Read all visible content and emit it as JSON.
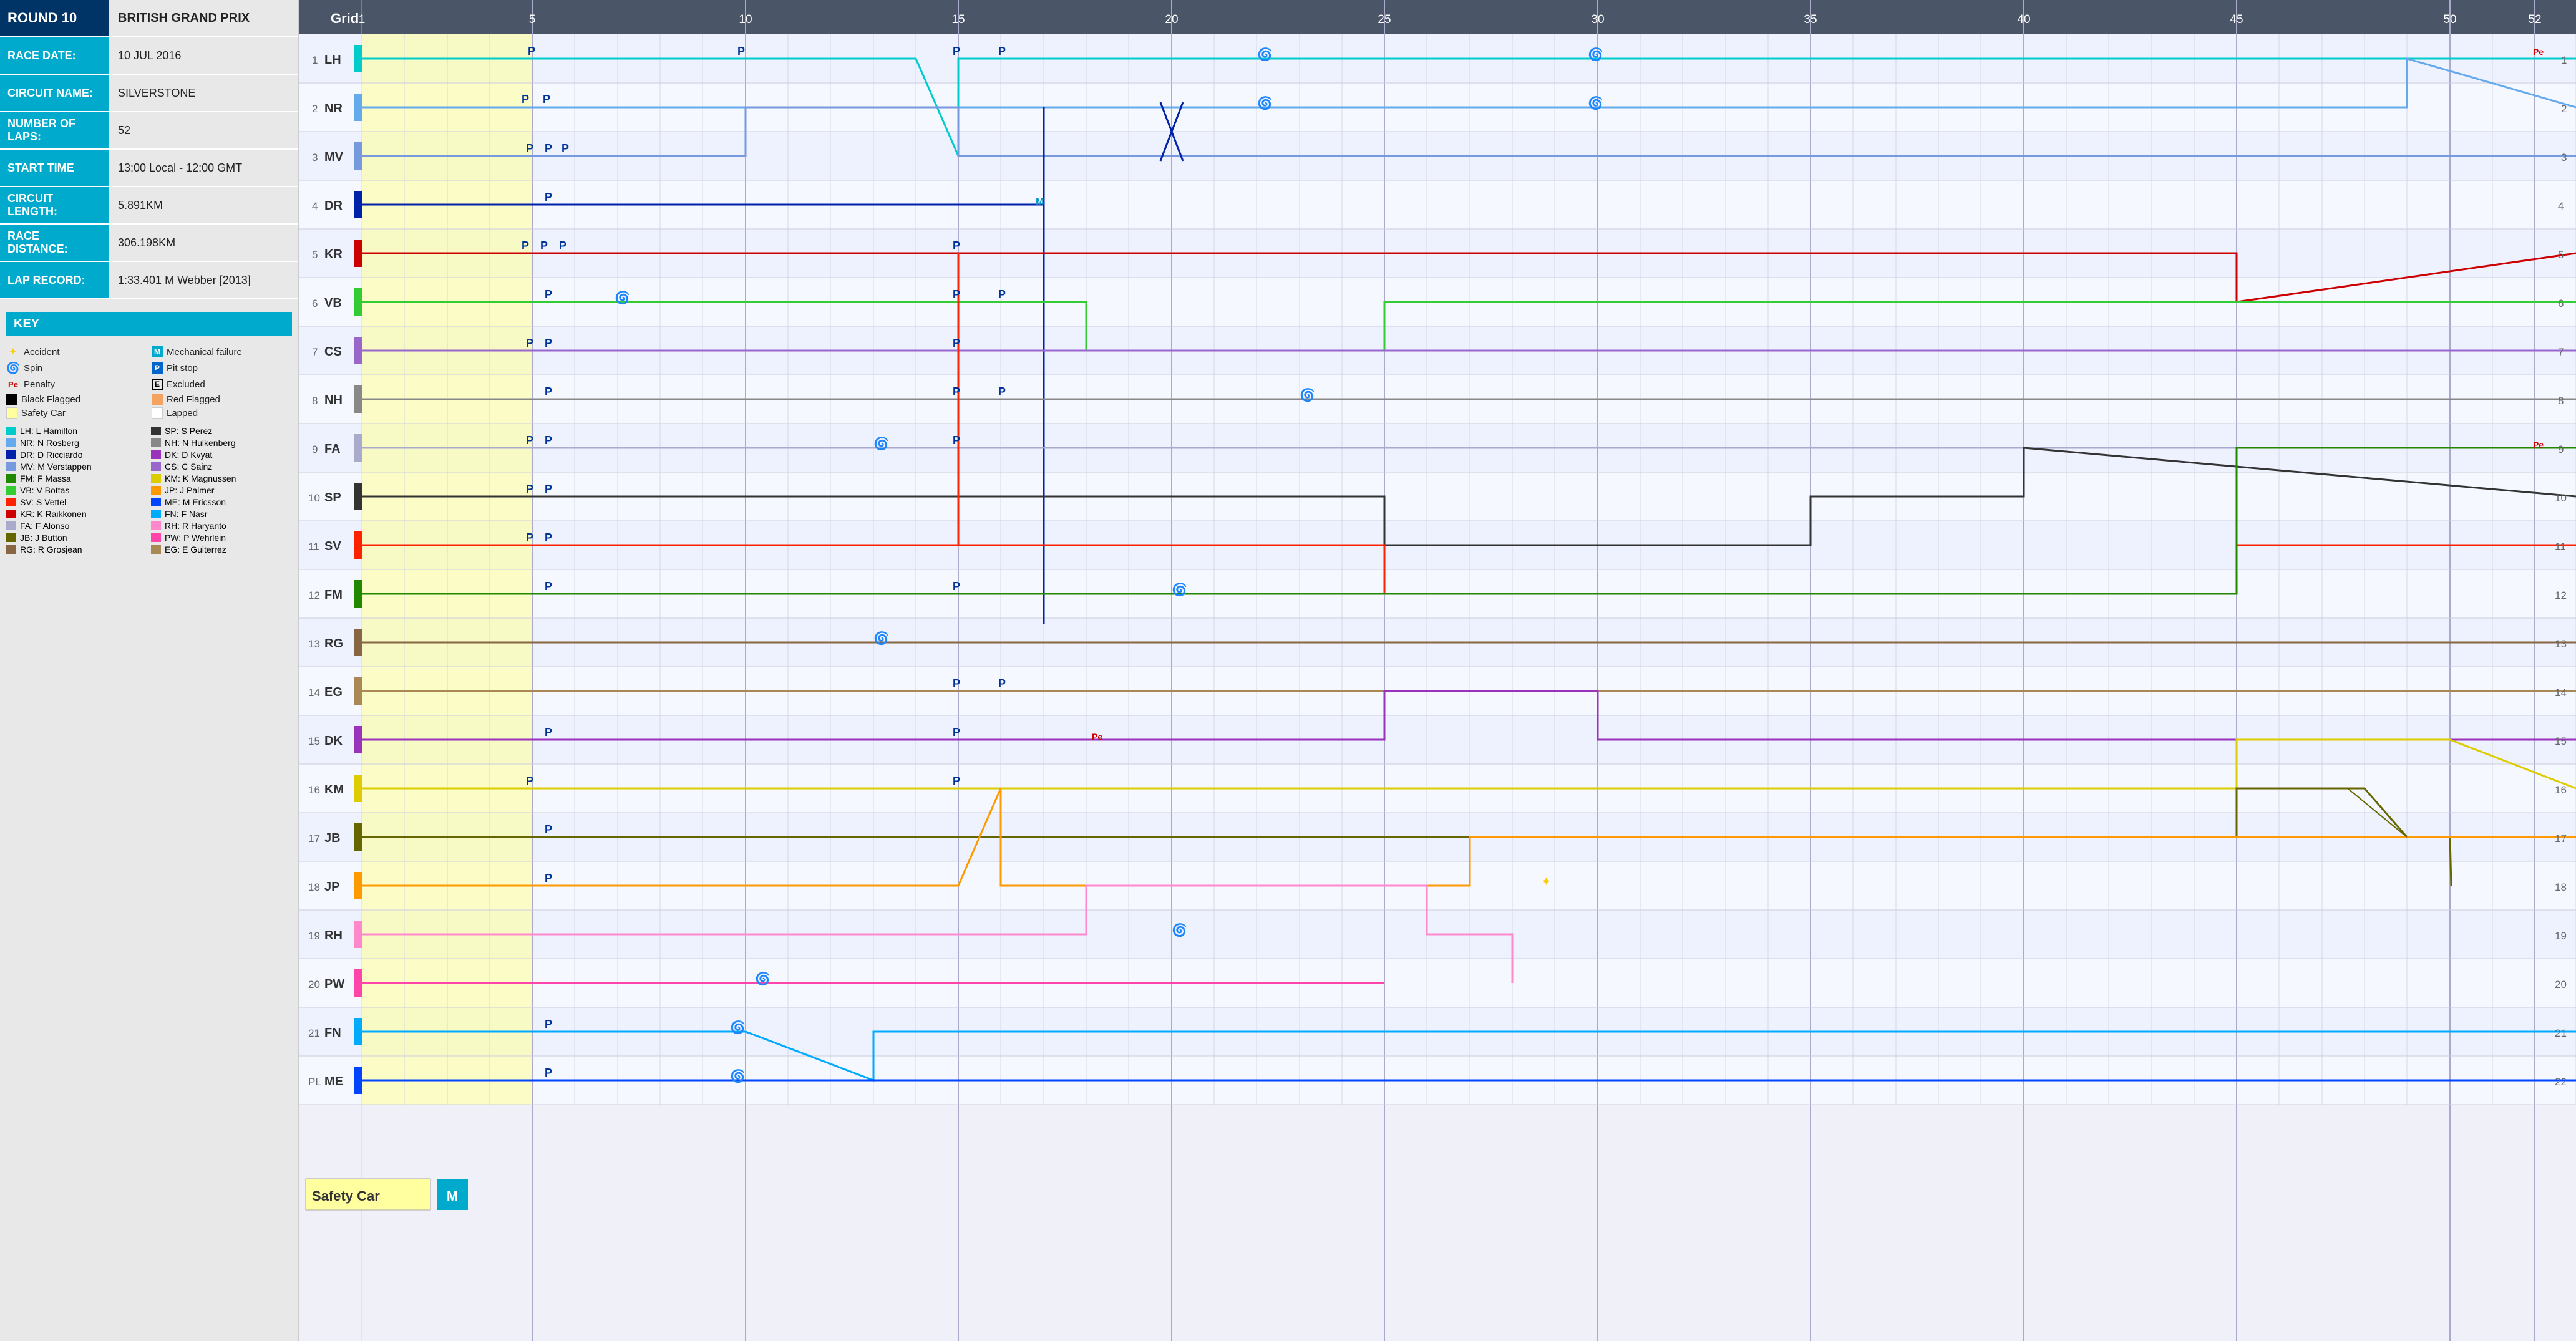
{
  "left_panel": {
    "round": "ROUND 10",
    "race_name": "BRITISH GRAND PRIX",
    "fields": [
      {
        "label": "RACE DATE:",
        "value": "10 JUL 2016"
      },
      {
        "label": "CIRCUIT NAME:",
        "value": "SILVERSTONE"
      },
      {
        "label": "NUMBER OF LAPS:",
        "value": "52"
      },
      {
        "label": "START TIME",
        "value": "13:00 Local - 12:00 GMT"
      },
      {
        "label": "CIRCUIT LENGTH:",
        "value": "5.891KM"
      },
      {
        "label": "RACE DISTANCE:",
        "value": "306.198KM"
      },
      {
        "label": "LAP RECORD:",
        "value": "1:33.401 M Webber [2013]"
      }
    ],
    "key": {
      "title": "KEY",
      "items_col1": [
        {
          "symbol": "⭐",
          "text": "Accident"
        },
        {
          "symbol": "M",
          "text": "Mechanical failure"
        },
        {
          "symbol": "🌀",
          "text": "Spin"
        },
        {
          "symbol": "P",
          "text": "Pit stop"
        },
        {
          "symbol": "Pe",
          "text": "Penalty"
        },
        {
          "symbol": "E",
          "text": "Excluded"
        },
        {
          "symbol": "■",
          "text": "Black Flagged"
        },
        {
          "symbol": "□",
          "text": "Red Flagged"
        },
        {
          "symbol": "□",
          "text": "Safety Car",
          "special": "yellow"
        },
        {
          "symbol": "□",
          "text": "Lapped"
        }
      ],
      "items_col2": [
        {
          "color": "#00cccc",
          "text": "LH: L Hamilton"
        },
        {
          "color": "#66aaee",
          "text": "NR: N Rosberg"
        },
        {
          "color": "#0022aa",
          "text": "DR: D Ricciardo"
        },
        {
          "color": "#7799dd",
          "text": "MV: M Verstappen"
        },
        {
          "color": "#228800",
          "text": "FM: F Massa"
        },
        {
          "color": "#33cc33",
          "text": "VB: V Bottas"
        },
        {
          "color": "#ff2200",
          "text": "SV: S Vettel"
        },
        {
          "color": "#cc0000",
          "text": "KR: K Raikkonen"
        },
        {
          "color": "#aaaacc",
          "text": "FA: F Alonso"
        },
        {
          "color": "#666600",
          "text": "JB: J Button"
        }
      ],
      "items_col3": [
        {
          "color": "#333333",
          "text": "SP: S Perez"
        },
        {
          "color": "#888888",
          "text": "NH: N Hulkenberg"
        },
        {
          "color": "#9933bb",
          "text": "DK: D Kvyat"
        },
        {
          "color": "#9966cc",
          "text": "CS: C Sainz"
        },
        {
          "color": "#ddcc00",
          "text": "KM: K Magnussen"
        },
        {
          "color": "#ff9900",
          "text": "JP: J Palmer"
        },
        {
          "color": "#00aaff",
          "text": "ME: M Ericsson"
        },
        {
          "color": "#ff88cc",
          "text": "FN: F Nasr"
        },
        {
          "color": "#ff44aa",
          "text": "RH: R Haryanto"
        },
        {
          "color": "#886644",
          "text": "PW: P Wehrlein"
        },
        {
          "color": "#aa8855",
          "text": "RG: R Grosjean"
        },
        {
          "color": "#aa8855",
          "text": "EG: E Guiterrez"
        }
      ]
    }
  },
  "chart": {
    "title": "Grid",
    "total_laps": 52,
    "lap_markers": [
      1,
      5,
      10,
      15,
      20,
      25,
      30,
      35,
      40,
      45,
      50,
      52
    ],
    "safety_car_laps": {
      "start": 1,
      "end": 5
    },
    "drivers": [
      {
        "pos": 1,
        "code": "LH",
        "color": "#00cccc"
      },
      {
        "pos": 2,
        "code": "NR",
        "color": "#66aaee"
      },
      {
        "pos": 3,
        "code": "MV",
        "color": "#7799dd"
      },
      {
        "pos": 4,
        "code": "DR",
        "color": "#0022aa"
      },
      {
        "pos": 5,
        "code": "KR",
        "color": "#cc0000"
      },
      {
        "pos": 6,
        "code": "VB",
        "color": "#33cc33"
      },
      {
        "pos": 7,
        "code": "CS",
        "color": "#9966cc"
      },
      {
        "pos": 8,
        "code": "NH",
        "color": "#888888"
      },
      {
        "pos": 9,
        "code": "FA",
        "color": "#aaaacc"
      },
      {
        "pos": 10,
        "code": "SP",
        "color": "#333333"
      },
      {
        "pos": 11,
        "code": "SV",
        "color": "#ff2200"
      },
      {
        "pos": 12,
        "code": "FM",
        "color": "#228800"
      },
      {
        "pos": 13,
        "code": "RG",
        "color": "#886644"
      },
      {
        "pos": 14,
        "code": "EG",
        "color": "#aa8855"
      },
      {
        "pos": 15,
        "code": "DK",
        "color": "#9933bb"
      },
      {
        "pos": 16,
        "code": "KM",
        "color": "#ddcc00"
      },
      {
        "pos": 17,
        "code": "JB",
        "color": "#666600"
      },
      {
        "pos": 18,
        "code": "JP",
        "color": "#ff9900"
      },
      {
        "pos": 19,
        "code": "RH",
        "color": "#ff88cc"
      },
      {
        "pos": 20,
        "code": "PW",
        "color": "#ff44aa"
      },
      {
        "pos": 21,
        "code": "FN",
        "color": "#00aaff"
      },
      {
        "pos": 22,
        "code": "ME",
        "color": "#0044ff"
      }
    ]
  },
  "safety_car_label": "Safety Car"
}
